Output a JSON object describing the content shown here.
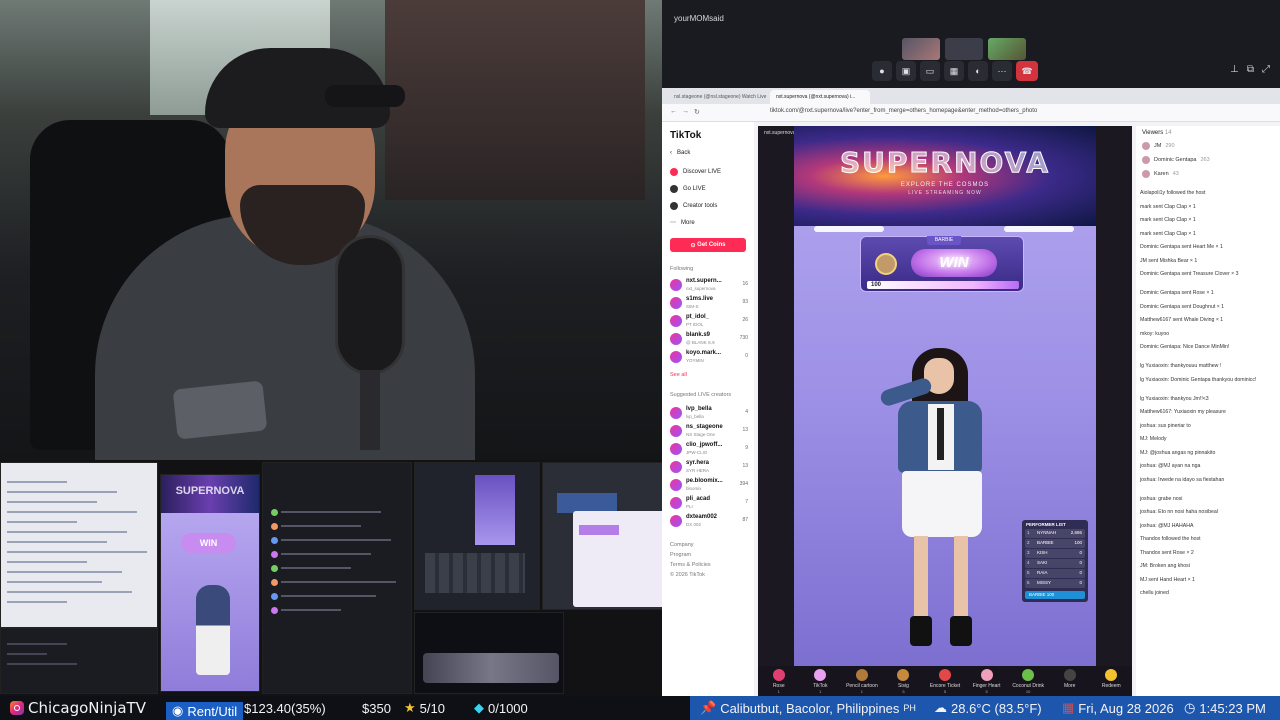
{
  "meeting": {
    "title": "yourMOMsaid"
  },
  "browser": {
    "tabs": [
      "nsl.stageone (@nsl.stageone) Watch Live",
      "nxt.supernova (@nxt.supernova) i..."
    ],
    "url": "tiktok.com/@nxt.supernova/live?enter_from_merge=others_homepage&enter_method=others_photo"
  },
  "tiktok_sidebar": {
    "logo": "TikTok",
    "back": "Back",
    "nav": [
      "Discover LIVE",
      "Go LIVE",
      "Creator tools",
      "More"
    ],
    "coins_button": "Get Coins",
    "following_heading": "Following",
    "following": [
      {
        "name": "nxt.supern...",
        "sub": "nxt_supernova",
        "count": "16"
      },
      {
        "name": "s1ms.live",
        "sub": "SIM-S",
        "count": "93"
      },
      {
        "name": "pt_idol_",
        "sub": "PT IDOL",
        "count": "26"
      },
      {
        "name": "blank.s9",
        "sub": "@ BLANK S.9",
        "count": "730"
      },
      {
        "name": "koyo.mark...",
        "sub": "YOYMIN",
        "count": "0"
      }
    ],
    "see_all": "See all",
    "suggested_heading": "Suggested LIVE creators",
    "suggested": [
      {
        "name": "lvp_bella",
        "sub": "lvp_bella",
        "count": "4"
      },
      {
        "name": "ns_stageone",
        "sub": "NS Stage One",
        "count": "13"
      },
      {
        "name": "clio_jpwoff...",
        "sub": "JPW-CLIO",
        "count": "9"
      },
      {
        "name": "syr.hera",
        "sub": "SYR HERA",
        "count": "13"
      },
      {
        "name": "pe.bloomix...",
        "sub": "bloomix",
        "count": "394"
      },
      {
        "name": "pli_acad",
        "sub": "PLI",
        "count": "7"
      },
      {
        "name": "dxteam002",
        "sub": "DX 002",
        "count": "87"
      }
    ],
    "footer": [
      "Company",
      "Program",
      "Terms & Policies",
      "© 2026 TikTok"
    ]
  },
  "stream": {
    "host": "nxt.supernova",
    "banner_title": "SUPERNOVA",
    "banner_sub": "EXPLORE THE COSMOS",
    "banner_sub2": "LIVE STREAMING NOW",
    "win_tag": "BARBIE",
    "win_label": "WIN",
    "win_value": "100",
    "performer_list": {
      "title": "PERFORMER LIST",
      "rows": [
        {
          "rank": "1",
          "name": "NYNNAH",
          "value": "2,686"
        },
        {
          "rank": "2",
          "name": "BARBIE",
          "value": "100"
        },
        {
          "rank": "3",
          "name": "KISH",
          "value": "0"
        },
        {
          "rank": "4",
          "name": "SAKI",
          "value": "0"
        },
        {
          "rank": "5",
          "name": "RAIA",
          "value": "0"
        },
        {
          "rank": "6",
          "name": "MISSY",
          "value": "0"
        }
      ],
      "footer": "BARBIE 100"
    },
    "gifts": [
      {
        "name": "Rose",
        "price": "1"
      },
      {
        "name": "TikTok",
        "price": "1"
      },
      {
        "name": "Pencil cartoon",
        "price": "1"
      },
      {
        "name": "Sisig",
        "price": "5"
      },
      {
        "name": "Encore Ticket",
        "price": "5"
      },
      {
        "name": "Finger Heart",
        "price": "5"
      },
      {
        "name": "Coconut Drink",
        "price": "10"
      },
      {
        "name": "More",
        "price": ""
      },
      {
        "name": "Redeem",
        "price": ""
      }
    ]
  },
  "chat": {
    "viewers_label": "Viewers",
    "viewers_count": "14",
    "viewers": [
      {
        "name": "JM",
        "count": "290"
      },
      {
        "name": "Dominic Gentapa",
        "count": "263"
      },
      {
        "name": "Karen",
        "count": "43"
      }
    ],
    "messages": [
      "Aiolapoli1y followed the host",
      "mark sent Clap Clap × 1",
      "mark sent Clap Clap × 1",
      "mark sent Clap Clap × 1",
      "Dominic Gentapa sent Heart Me × 1",
      "JM sent Mishka Bear × 1",
      "Dominic Gentapa sent Treasure Clover × 3",
      "Dominic Gentapa sent Rose × 1",
      "Dominic Gentapa sent Doughnut × 1",
      "Matthew6167 sent Whale Diving × 1",
      "mkoy: kuyoo",
      "Dominic Gentapa: Nice Dance MinMin!",
      "lg Yuxiaoxin: thankyouuu matthew !",
      "lg Yuxiaoxin: Dominic Gentapa thankyou dominicc!",
      "lg Yuxiaoxin: thankyou Jm!!<3",
      "Matthew6167: Yuxiaoxin my pleasure",
      "joshua: sus pineriar to",
      "MJ: Melody",
      "MJ: @joshua angas ng pinnakito",
      "joshua: @MJ ayan na nga",
      "joshua: Irwede na idayo sa fiestahan",
      "joshua: grabe nosi",
      "joshua: Eto nn nosi haha nosibeal",
      "joshua: @MJ HAHAHA",
      "Thandox followed the host",
      "Thandox sent Rose × 2",
      "JM: Broken ang khosi",
      "MJ sent Hand Heart × 1",
      "chellu joined"
    ]
  },
  "bottom_bar": {
    "channel": "ChicagoNinjaTV",
    "rent_label": "Rent/Util",
    "rent_value": "$123.40(35%)",
    "goal": "$350",
    "stars": "5/10",
    "gems": "0/1000",
    "location": "Calibutbut, Bacolor, Philippines",
    "location_suffix": "PH",
    "weather": "28.6°C (83.5°F)",
    "date": "Fri, Aug 28 2026",
    "time": "1:45:23 PM"
  },
  "thumbnails": {
    "tk_win": "WIN",
    "tk_banner": "SUPERNOVA"
  },
  "colors": {
    "tiktok_pink": "#fe2c55",
    "overlay_blue": "#1d56ad",
    "rent_blue": "#1b5fc4",
    "stage_purple": "#9d90e6",
    "end_call_red": "#d2333c"
  }
}
